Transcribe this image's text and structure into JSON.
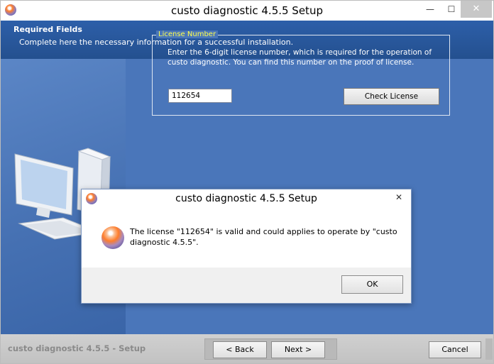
{
  "window": {
    "title": "custo diagnostic 4.5.5 Setup",
    "minimize_glyph": "—",
    "maximize_glyph": "☐",
    "close_glyph": "✕"
  },
  "header": {
    "title": "Required Fields",
    "subtitle": "Complete here the necessary information for a successful installation."
  },
  "license_group": {
    "legend": "License Number",
    "description": "Enter the 6-digit license number, which is required for the operation of custo diagnostic. You can find this number on the proof of license.",
    "input_value": "112654",
    "check_button": "Check License"
  },
  "footer": {
    "brand": "custo diagnostic 4.5.5 - Setup",
    "back_label": "< Back",
    "next_label": "Next >",
    "cancel_label": "Cancel"
  },
  "dialog": {
    "title": "custo diagnostic 4.5.5 Setup",
    "close_glyph": "✕",
    "message": "The license \"112654\" is valid and could applies to operate by \"custo diagnostic 4.5.5\".",
    "ok_label": "OK"
  },
  "colors": {
    "header_blue": "#2b5aa3",
    "body_blue": "#4a76ba",
    "legend_yellow": "#ffff4c"
  },
  "icons": [
    "app-orb-icon",
    "computer-icon",
    "info-orb-icon"
  ]
}
